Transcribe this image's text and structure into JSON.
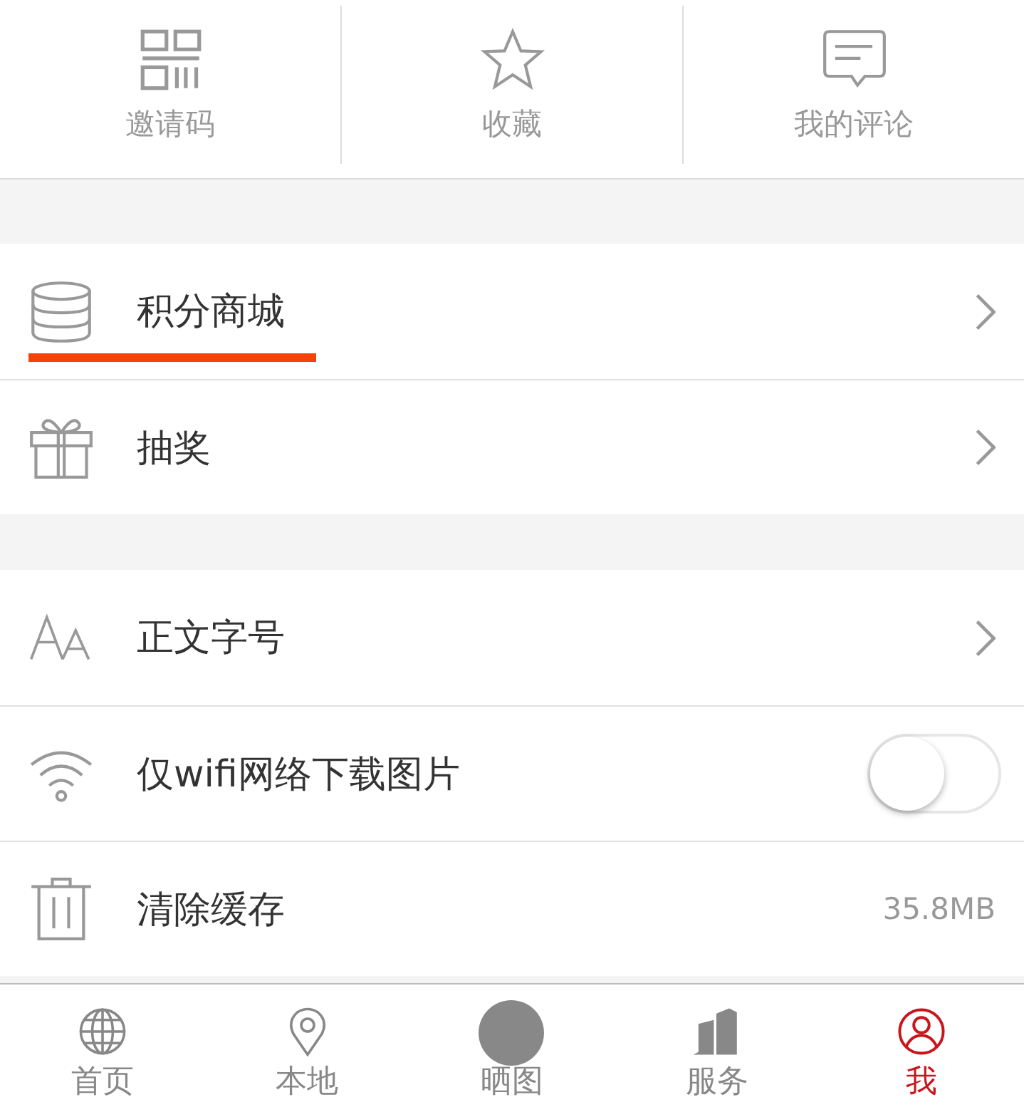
{
  "shortcuts": [
    {
      "label": "邀请码"
    },
    {
      "label": "收藏"
    },
    {
      "label": "我的评论"
    }
  ],
  "groups": [
    {
      "rows": [
        {
          "kind": "link",
          "label": "积分商城",
          "highlighted": true
        },
        {
          "kind": "link",
          "label": "抽奖",
          "highlighted": false
        }
      ]
    },
    {
      "rows": [
        {
          "kind": "link",
          "label": "正文字号",
          "highlighted": false
        },
        {
          "kind": "toggle",
          "label": "仅wifi网络下载图片",
          "on": false,
          "highlighted": false
        },
        {
          "kind": "value",
          "label": "清除缓存",
          "value": "35.8MB",
          "highlighted": false
        }
      ]
    }
  ],
  "tab_bar": [
    {
      "label": "首页",
      "selected": false
    },
    {
      "label": "本地",
      "selected": false
    },
    {
      "label": "晒图",
      "selected": false
    },
    {
      "label": "服务",
      "selected": false
    },
    {
      "label": "我",
      "selected": true
    }
  ]
}
